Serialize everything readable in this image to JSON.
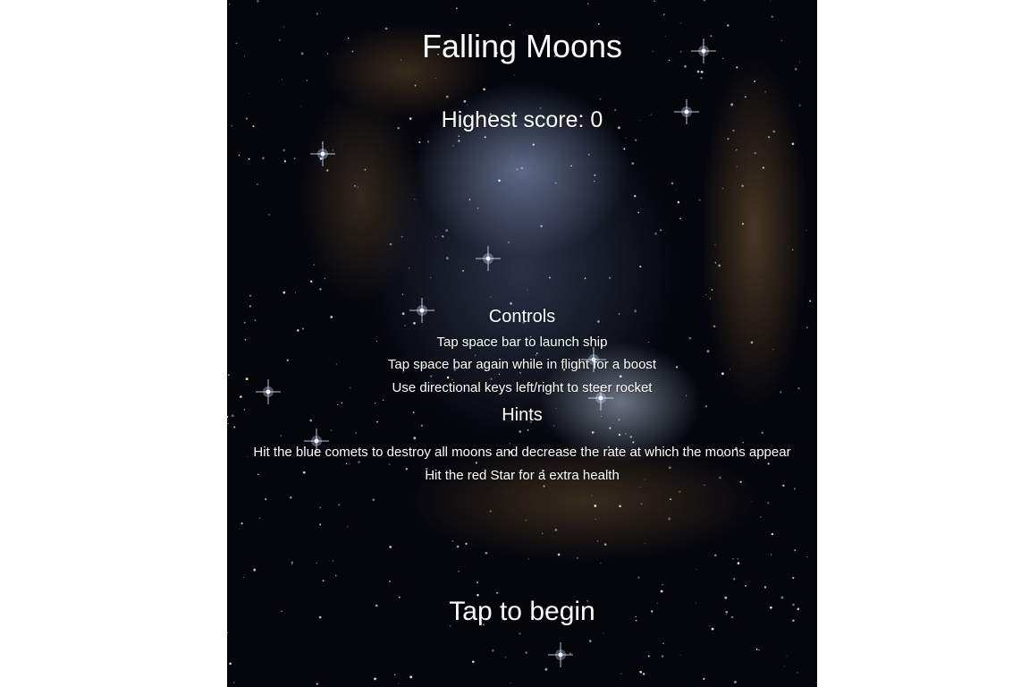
{
  "game": {
    "title": "Falling Moons",
    "highest_score": "Highest score: 0",
    "controls_heading": "Controls",
    "controls": [
      "Tap space bar to launch ship",
      "Tap space bar again while in flight for a boost",
      "Use directional keys left/right to steer rocket"
    ],
    "hints_heading": "Hints",
    "hints": [
      "Hit the blue comets to destroy all moons and decrease the rate at which the moons appear",
      "Hit the red Star for a extra health"
    ],
    "start_prompt": "Tap to begin"
  },
  "colors": {
    "text": "#ffffff",
    "space_background": "#05060c",
    "page_background": "#ffffff"
  }
}
